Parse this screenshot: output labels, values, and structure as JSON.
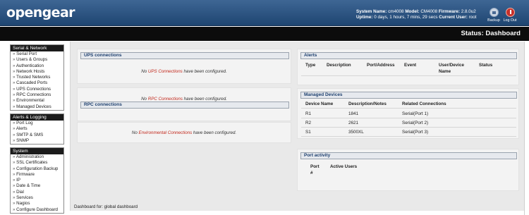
{
  "header": {
    "logo": "opengear",
    "system_name_label": "System Name:",
    "system_name": "cm4008",
    "model_label": "Model:",
    "model": "CM4008",
    "firmware_label": "Firmware:",
    "firmware": "2.8.0u2",
    "uptime_label": "Uptime:",
    "uptime": "0 days, 1 hours, 7 mins, 29 secs",
    "current_user_label": "Current User:",
    "current_user": "root",
    "backup_label": "Backup",
    "logout_label": "Log Out"
  },
  "title": "Status: Dashboard",
  "sidebar": {
    "serial_network": {
      "heading": "Serial & Network",
      "items": [
        "Serial Port",
        "Users & Groups",
        "Authentication",
        "Network Hosts",
        "Trusted Networks",
        "Cascaded Ports",
        "UPS Connections",
        "RPC Connections",
        "Environmental",
        "Managed Devices"
      ]
    },
    "alerts_logging": {
      "heading": "Alerts & Logging",
      "items": [
        "Port Log",
        "Alerts",
        "SMTP & SMS",
        "SNMP"
      ]
    },
    "system": {
      "heading": "System",
      "items": [
        "Administration",
        "SSL Certificates",
        "Configuration Backup",
        "Firmware",
        "IP",
        "Date & Time",
        "Dial",
        "Services",
        "Nagios",
        "Configure Dashboard"
      ]
    }
  },
  "ups": {
    "title": "UPS connections",
    "msg_pre": "No ",
    "msg_link": "UPS Connections",
    "msg_post": " have been configured."
  },
  "rpc": {
    "title": "RPC connections",
    "msg_pre": "No ",
    "msg_link": "RPC Connections",
    "msg_post": " have been configured."
  },
  "env": {
    "msg_pre": "No ",
    "msg_link": "Environmental Connections",
    "msg_post": " have been configured."
  },
  "alerts": {
    "title": "Alerts",
    "columns": [
      "Type",
      "Description",
      "Port/Address",
      "Event",
      "User/Device Name",
      "Status"
    ]
  },
  "managed_devices": {
    "title": "Managed Devices",
    "columns": [
      "Device Name",
      "Description/Notes",
      "Related Connections"
    ],
    "rows": [
      [
        "R1",
        "1841",
        "Serial(Port 1)"
      ],
      [
        "R2",
        "2621",
        "Serial(Port 2)"
      ],
      [
        "S1",
        "3500XL",
        "Serial(Port 3)"
      ]
    ]
  },
  "port_activity": {
    "title": "Port activity",
    "columns": [
      "Port #",
      "Active Users"
    ]
  },
  "footer": "Dashboard for: global dashboard"
}
